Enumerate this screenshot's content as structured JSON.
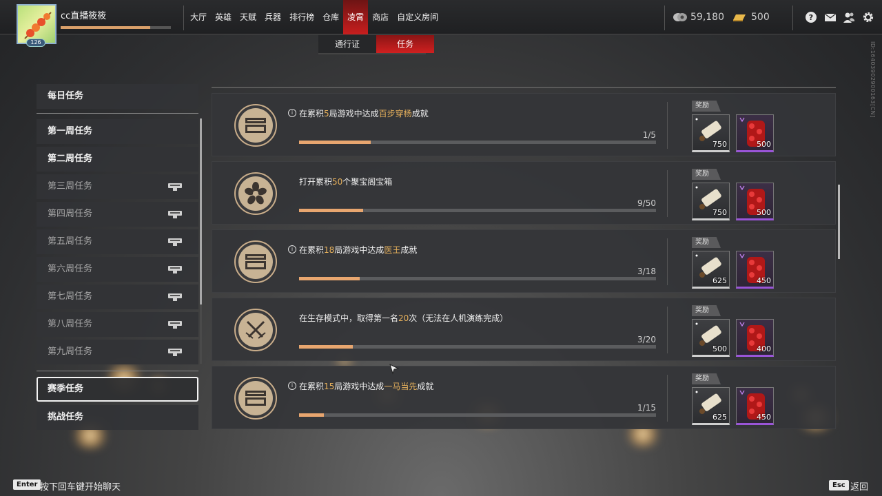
{
  "player": {
    "name": "cc直播筱筱",
    "level": "126",
    "exp_progress": 0.81
  },
  "nav": {
    "items": [
      {
        "label": "大厅",
        "active": false
      },
      {
        "label": "英雄",
        "active": false
      },
      {
        "label": "天赋",
        "active": false
      },
      {
        "label": "兵器",
        "active": false
      },
      {
        "label": "排行榜",
        "active": false
      },
      {
        "label": "仓库",
        "active": false
      },
      {
        "label": "凌霄",
        "active": true
      },
      {
        "label": "商店",
        "active": false
      },
      {
        "label": "自定义房间",
        "active": false
      }
    ]
  },
  "currency": {
    "coins": "59,180",
    "gold": "500"
  },
  "subtabs": [
    {
      "label": "通行证",
      "active": false
    },
    {
      "label": "任务",
      "active": true
    }
  ],
  "side_id": "ID:16403902900163[CN]",
  "menu": {
    "items": [
      {
        "label": "每日任务",
        "locked": false
      },
      {
        "label": "第一周任务",
        "locked": false
      },
      {
        "label": "第二周任务",
        "locked": false
      },
      {
        "label": "第三周任务",
        "locked": true
      },
      {
        "label": "第四周任务",
        "locked": true
      },
      {
        "label": "第五周任务",
        "locked": true
      },
      {
        "label": "第六周任务",
        "locked": true
      },
      {
        "label": "第七周任务",
        "locked": true
      },
      {
        "label": "第八周任务",
        "locked": true
      },
      {
        "label": "第九周任务",
        "locked": true
      },
      {
        "label": "赛季任务",
        "locked": false,
        "selected": true
      },
      {
        "label": "挑战任务",
        "locked": false
      }
    ]
  },
  "reward_label": "奖励",
  "tasks": [
    {
      "icon": "chest-icon",
      "info": true,
      "desc_pre": "在累积",
      "desc_hl1": "5",
      "desc_mid": "局游戏中达成",
      "desc_hl2": "百步穿杨",
      "desc_post": "成就",
      "progress_text": "1/5",
      "progress": 0.2,
      "reward1": "750",
      "reward2": "500"
    },
    {
      "icon": "flower-icon",
      "info": false,
      "desc_pre": "打开累积",
      "desc_hl1": "50",
      "desc_mid": "个聚宝阁宝箱",
      "desc_hl2": "",
      "desc_post": "",
      "progress_text": "9/50",
      "progress": 0.18,
      "reward1": "750",
      "reward2": "500"
    },
    {
      "icon": "chest-icon",
      "info": true,
      "desc_pre": "在累积",
      "desc_hl1": "18",
      "desc_mid": "局游戏中达成",
      "desc_hl2": "医王",
      "desc_post": "成就",
      "progress_text": "3/18",
      "progress": 0.17,
      "reward1": "625",
      "reward2": "450"
    },
    {
      "icon": "crossed-swords-icon",
      "info": false,
      "desc_pre": "在生存模式中，取得第一名",
      "desc_hl1": "20",
      "desc_mid": "次（无法在人机演练完成）",
      "desc_hl2": "",
      "desc_post": "",
      "progress_text": "3/20",
      "progress": 0.15,
      "reward1": "500",
      "reward2": "400"
    },
    {
      "icon": "chest-icon",
      "info": true,
      "desc_pre": "在累积",
      "desc_hl1": "15",
      "desc_mid": "局游戏中达成",
      "desc_hl2": "一马当先",
      "desc_post": "成就",
      "progress_text": "1/15",
      "progress": 0.07,
      "reward1": "625",
      "reward2": "450"
    }
  ],
  "footer": {
    "enter_key": "Enter",
    "enter_text": "按下回车键开始聊天",
    "esc_key": "Esc",
    "esc_text": "返回"
  },
  "colors": {
    "accent_red": "#c81e1e",
    "highlight": "#e7b15c",
    "progress": "#e8a66f",
    "epic_purple": "#9a55d8"
  }
}
